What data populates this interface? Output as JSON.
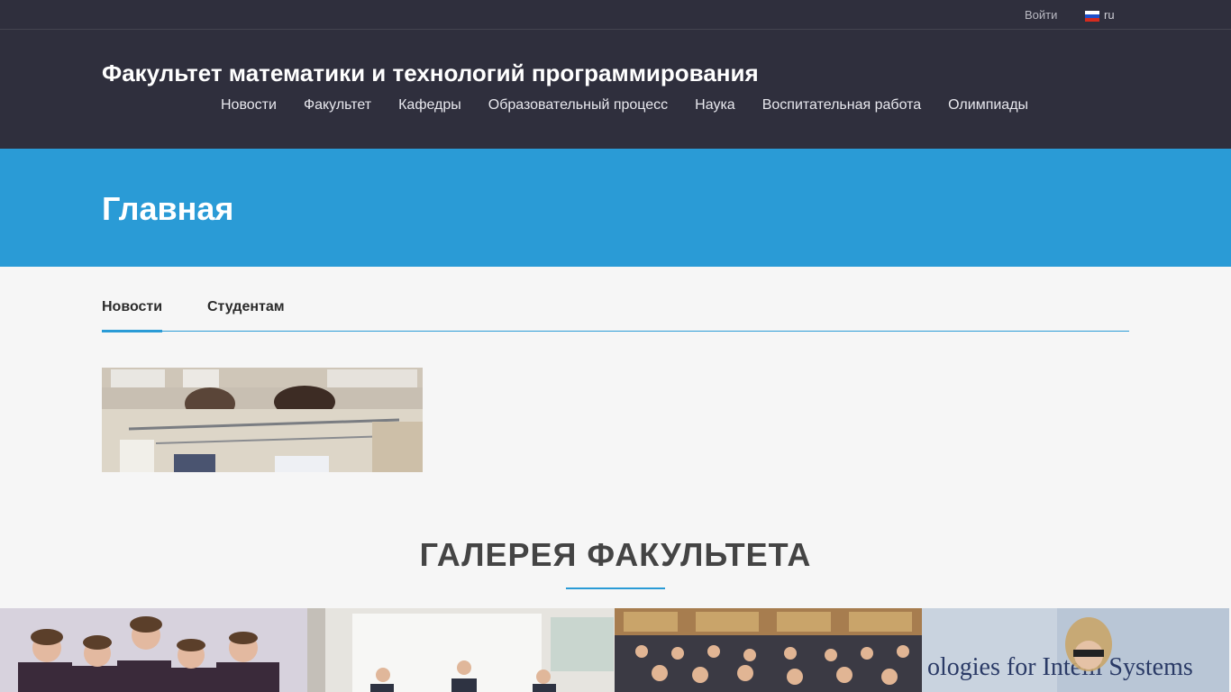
{
  "topbar": {
    "login_label": "Войти",
    "language": "ru"
  },
  "header": {
    "site_title": "Факультет математики и технологий программирования",
    "nav": [
      {
        "label": "Новости"
      },
      {
        "label": "Факультет"
      },
      {
        "label": "Кафедры"
      },
      {
        "label": "Образовательный процесс"
      },
      {
        "label": "Наука"
      },
      {
        "label": "Воспитательная работа"
      },
      {
        "label": "Олимпиады"
      }
    ]
  },
  "banner": {
    "page_title": "Главная"
  },
  "tabs": [
    {
      "label": "Новости",
      "active": true
    },
    {
      "label": "Студентам",
      "active": false
    }
  ],
  "gallery": {
    "title": "ГАЛЕРЕЯ ФАКУЛЬТЕТА",
    "photo4_caption": "ologies for Intelli Systems"
  },
  "colors": {
    "header_bg": "#2f2f3d",
    "accent": "#2a9bd6",
    "page_bg": "#f6f6f6"
  }
}
